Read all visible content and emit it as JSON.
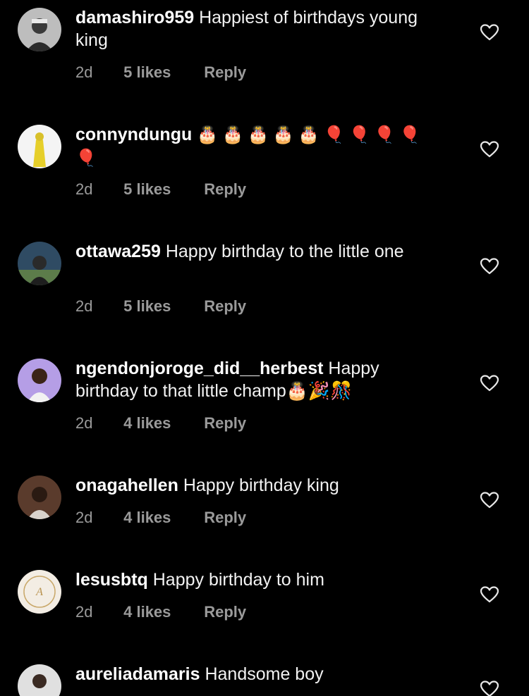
{
  "comments": [
    {
      "username": "damashiro959",
      "text": "Happiest of birthdays young king",
      "time": "2d",
      "likes": "5 likes",
      "reply": "Reply",
      "avatar_color": "#8c8c8c"
    },
    {
      "username": "connyndungu",
      "text": "🎂🎂🎂🎂🎂🎈🎈🎈🎈🎈",
      "time": "2d",
      "likes": "5 likes",
      "reply": "Reply",
      "avatar_color": "#e8d33a"
    },
    {
      "username": "ottawa259",
      "text": "Happy birthday to the little one",
      "time": "2d",
      "likes": "5 likes",
      "reply": "Reply",
      "avatar_color": "#3b5a78"
    },
    {
      "username": "ngendonjoroge_did__herbest",
      "text": "Happy birthday to that little champ🎂🎉🎊",
      "time": "2d",
      "likes": "4 likes",
      "reply": "Reply",
      "avatar_color": "#9b7fd4"
    },
    {
      "username": "onagahellen",
      "text": "Happy birthday king",
      "time": "2d",
      "likes": "4 likes",
      "reply": "Reply",
      "avatar_color": "#6b4a3a"
    },
    {
      "username": "lesusbtq",
      "text": "Happy birthday to him",
      "time": "2d",
      "likes": "4 likes",
      "reply": "Reply",
      "avatar_color": "#f3ede4"
    },
    {
      "username": "aureliadamaris",
      "text": "Handsome boy",
      "time": "",
      "likes": "",
      "reply": "",
      "avatar_color": "#cfcfcf"
    }
  ],
  "colors": {
    "background": "#000000",
    "meta": "#9a9a9a",
    "text": "#f2f2f2"
  },
  "icons": {
    "like": "heart-outline-icon"
  }
}
